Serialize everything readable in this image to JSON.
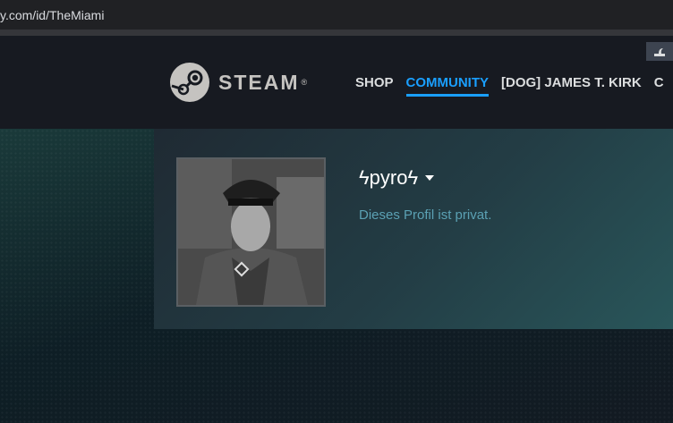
{
  "browser": {
    "url_fragment": "y.com/id/TheMiami"
  },
  "header": {
    "logo_text": "STEAM",
    "logo_reg": "®",
    "nav": [
      {
        "label": "SHOP",
        "active": false
      },
      {
        "label": "COMMUNITY",
        "active": true
      },
      {
        "label": "[DOG] JAMES T. KIRK",
        "active": false
      },
      {
        "label": "C",
        "active": false
      }
    ],
    "install_icon": "install-steam-icon"
  },
  "profile": {
    "persona_name": "ϟpyroϟ",
    "private_message": "Dieses Profil ist privat.",
    "avatar_icon": "user-avatar"
  },
  "colors": {
    "accent": "#1a9fff",
    "header_bg": "#171a21",
    "private_text": "#5ba1b4"
  }
}
